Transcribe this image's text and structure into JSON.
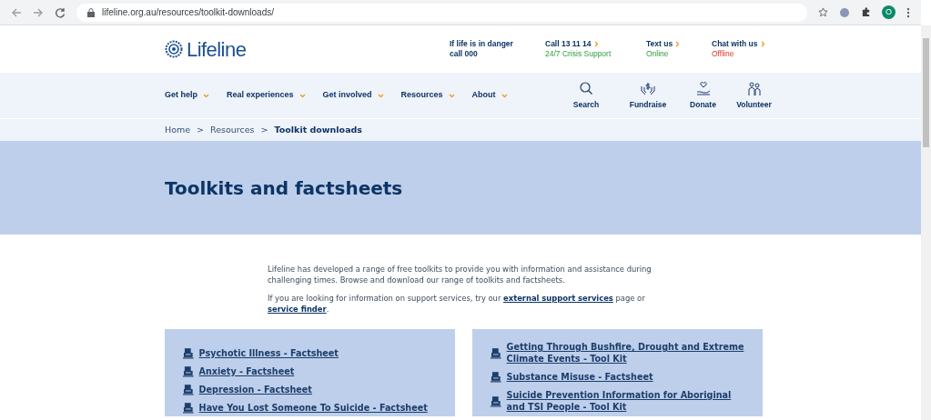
{
  "browser": {
    "url": "lifeline.org.au/resources/toolkit-downloads/",
    "avatar": "O"
  },
  "header": {
    "logo": "Lifeline",
    "contacts": [
      {
        "kind": "alert",
        "title": "If life is in danger",
        "subtitle": "call 000"
      },
      {
        "kind": "link",
        "title": "Call 13 11 14",
        "subtitle": "24/7 Crisis Support",
        "available": true
      },
      {
        "kind": "link",
        "title": "Text us",
        "subtitle": "Online",
        "available": true
      },
      {
        "kind": "link",
        "title": "Chat with us",
        "subtitle": "Offline",
        "available": false
      }
    ]
  },
  "nav": {
    "menus": [
      "Get help",
      "Real experiences",
      "Get involved",
      "Resources",
      "About"
    ],
    "actions": [
      {
        "kind": "search",
        "label": "Search"
      },
      {
        "kind": "fundraise",
        "label": "Fundraise"
      },
      {
        "kind": "donate",
        "label": "Donate"
      },
      {
        "kind": "volunteer",
        "label": "Volunteer"
      }
    ]
  },
  "breadcrumb": [
    {
      "kind": "link",
      "text": "Home"
    },
    {
      "kind": "separator",
      "text": ">"
    },
    {
      "kind": "link",
      "text": "Resources"
    },
    {
      "kind": "separator",
      "text": ">"
    },
    {
      "kind": "current",
      "text": "Toolkit downloads"
    }
  ],
  "hero": {
    "title": "Toolkits and factsheets"
  },
  "intro": [
    [
      {
        "kind": "text",
        "text": "Lifeline has developed a range of free toolkits to provide you with information and assistance during challenging times. Browse and download our range of toolkits and factsheets."
      }
    ],
    [
      {
        "kind": "text",
        "text": "If you are looking for information on support services, try our "
      },
      {
        "kind": "link",
        "text": "external support services"
      },
      {
        "kind": "text",
        "text": " page or "
      },
      {
        "kind": "link",
        "text": "service finder"
      },
      {
        "kind": "text",
        "text": "."
      }
    ]
  ],
  "downloads": [
    [
      "Psychotic Illness - Factsheet",
      "Anxiety - Factsheet",
      "Depression - Factsheet",
      "Have You Lost Someone To Suicide - Factsheet"
    ],
    [
      "Getting Through Bushfire, Drought and Extreme Climate Events - Tool Kit",
      "Substance Misuse - Factsheet",
      "Suicide Prevention Information for Aboriginal and TSI People - Tool Kit"
    ]
  ]
}
